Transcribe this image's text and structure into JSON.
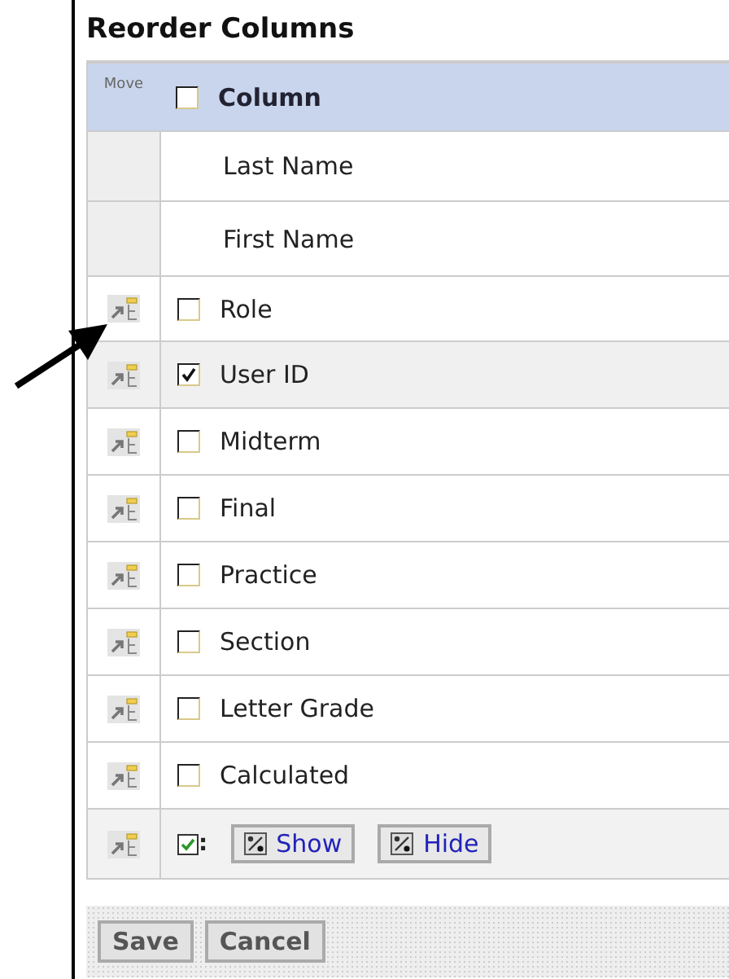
{
  "title": "Reorder Columns",
  "header": {
    "move_label": "Move",
    "checked": false,
    "column_label": "Column"
  },
  "rows": [
    {
      "kind": "fixed",
      "label": "Last Name"
    },
    {
      "kind": "fixed",
      "label": "First Name"
    },
    {
      "kind": "movable",
      "label": "Role",
      "checked": false
    },
    {
      "kind": "movable",
      "label": "User ID",
      "checked": true
    },
    {
      "kind": "movable",
      "label": "Midterm",
      "checked": false
    },
    {
      "kind": "movable",
      "label": "Final",
      "checked": false
    },
    {
      "kind": "movable",
      "label": "Practice",
      "checked": false
    },
    {
      "kind": "movable",
      "label": "Section",
      "checked": false
    },
    {
      "kind": "movable",
      "label": "Letter Grade",
      "checked": false
    },
    {
      "kind": "movable",
      "label": "Calculated",
      "checked": false
    }
  ],
  "bulk_actions": {
    "separator": ":",
    "buttons": [
      "Show",
      "Hide"
    ]
  },
  "footer_buttons": [
    "Save",
    "Cancel"
  ]
}
